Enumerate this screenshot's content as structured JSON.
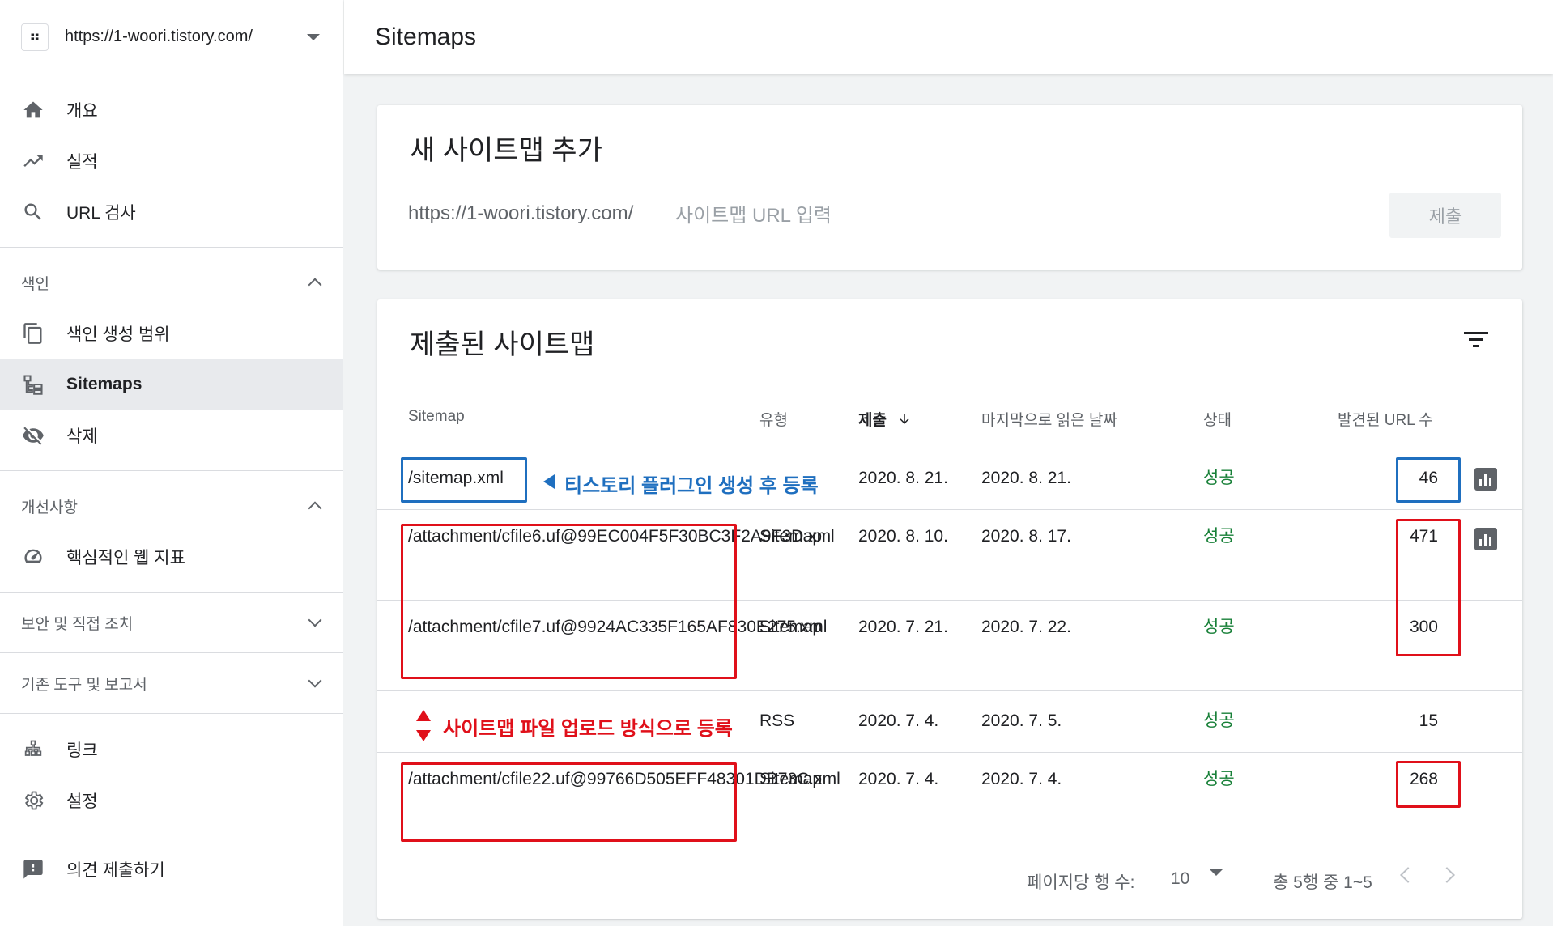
{
  "property": {
    "url": "https://1-woori.tistory.com/",
    "icon": "tistory-logo-icon"
  },
  "sidebar": {
    "top_items": [
      {
        "label": "개요",
        "icon": "home-icon"
      },
      {
        "label": "실적",
        "icon": "trending-up-icon"
      },
      {
        "label": "URL 검사",
        "icon": "search-icon"
      }
    ],
    "index_section": {
      "title": "색인",
      "items": [
        {
          "label": "색인 생성 범위",
          "icon": "copy-icon"
        },
        {
          "label": "Sitemaps",
          "icon": "sitemap-icon"
        },
        {
          "label": "삭제",
          "icon": "eye-off-icon"
        }
      ]
    },
    "enhance_section": {
      "title": "개선사항",
      "items": [
        {
          "label": "핵심적인 웹 지표",
          "icon": "speed-icon"
        }
      ]
    },
    "security_section": {
      "title": "보안 및 직접 조치"
    },
    "legacy_section": {
      "title": "기존 도구 및 보고서"
    },
    "bottom_items": [
      {
        "label": "링크",
        "icon": "links-icon"
      },
      {
        "label": "설정",
        "icon": "gear-icon"
      }
    ],
    "feedback": {
      "label": "의견 제출하기",
      "icon": "feedback-icon"
    }
  },
  "header": {
    "title": "Sitemaps"
  },
  "add_card": {
    "title": "새 사이트맵 추가",
    "prefix": "https://1-woori.tistory.com/",
    "input_placeholder": "사이트맵 URL 입력",
    "input_value": "",
    "submit_label": "제출"
  },
  "list_card": {
    "title": "제출된 사이트맵",
    "columns": {
      "sitemap": "Sitemap",
      "type": "유형",
      "submitted": "제출",
      "last_read": "마지막으로 읽은 날짜",
      "status": "상태",
      "urls": "발견된 URL 수"
    },
    "rows": [
      {
        "path": "/sitemap.xml",
        "type": "",
        "submitted": "2020. 8. 21.",
        "last_read": "2020. 8. 21.",
        "status": "성공",
        "urls": "46"
      },
      {
        "path": "/attachment/cfile6.uf@99EC004F5F30BC3F2A9F3D.xml",
        "type": "Sitemap",
        "submitted": "2020. 8. 10.",
        "last_read": "2020. 8. 17.",
        "status": "성공",
        "urls": "471"
      },
      {
        "path": "/attachment/cfile7.uf@9924AC335F165AF830E275.xml",
        "type": "Sitemap",
        "submitted": "2020. 7. 21.",
        "last_read": "2020. 7. 22.",
        "status": "성공",
        "urls": "300"
      },
      {
        "path": "",
        "type": "RSS",
        "submitted": "2020. 7. 4.",
        "last_read": "2020. 7. 5.",
        "status": "성공",
        "urls": "15"
      },
      {
        "path": "/attachment/cfile22.uf@99766D505EFF48301DB73C.xml",
        "type": "Sitemap",
        "submitted": "2020. 7. 4.",
        "last_read": "2020. 7. 4.",
        "status": "성공",
        "urls": "268"
      }
    ],
    "footer": {
      "rows_per_page_label": "페이지당 행 수:",
      "rows_per_page_value": "10",
      "range_text": "총 5행 중 1~5"
    }
  },
  "annotations": {
    "blue_note": "티스토리 플러그인 생성 후 등록",
    "red_note": "사이트맵 파일 업로드 방식으로 등록"
  },
  "colors": {
    "success": "#188038",
    "annotation_blue": "#1f6fbf",
    "annotation_red": "#e0101a"
  }
}
